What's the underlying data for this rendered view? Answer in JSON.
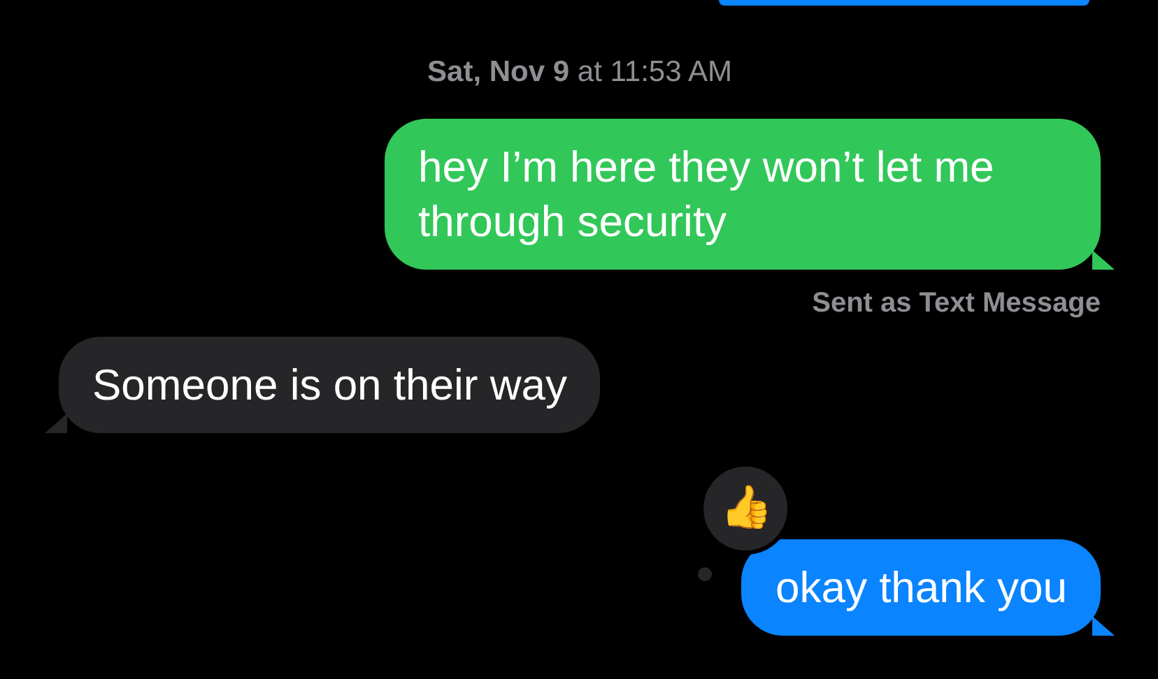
{
  "timestamp": "**Sat, Nov 9** at 11:53 AM",
  "messages": [
    {
      "kind": "imessage",
      "partial": true
    },
    {
      "kind": "sms",
      "text": "hey I’m here they won’t let me through security",
      "note": "Sent as Text Message"
    },
    {
      "kind": "received",
      "text": "Someone is on their way"
    },
    {
      "kind": "imessage",
      "text": "okay thank you",
      "reaction": "👍"
    }
  ]
}
